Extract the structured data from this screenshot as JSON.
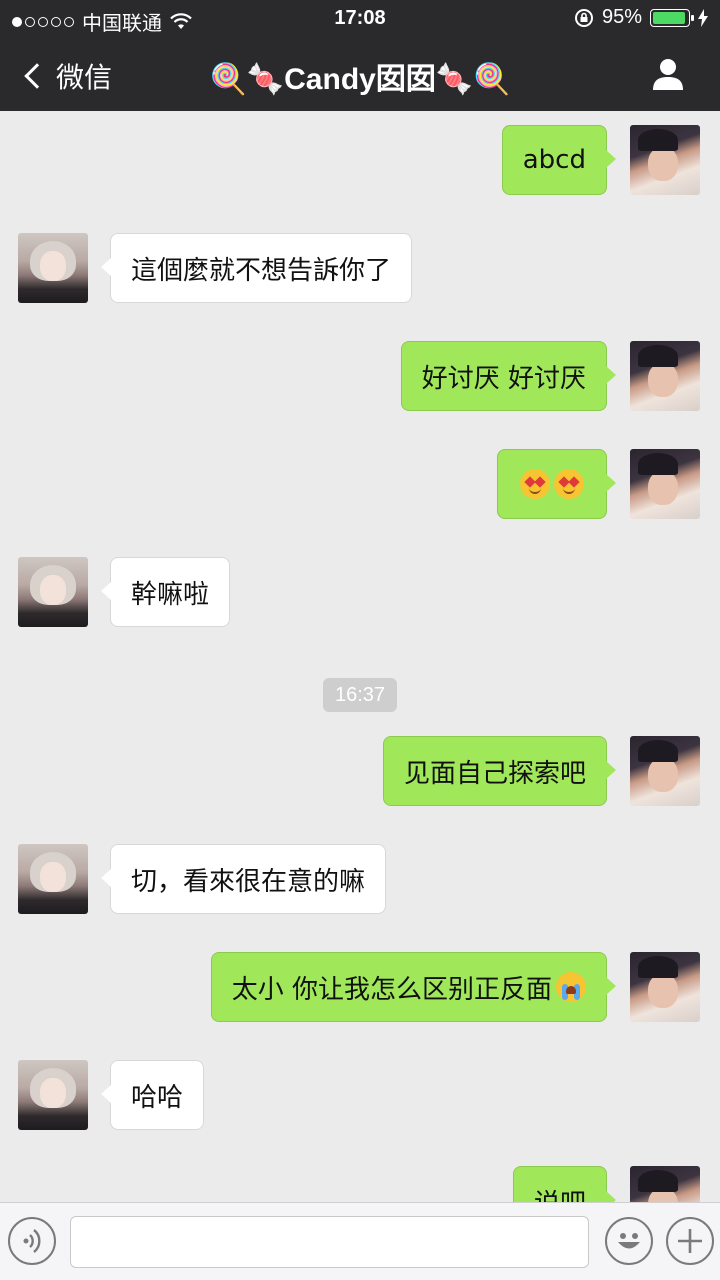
{
  "status_bar": {
    "carrier": "中国联通",
    "time": "17:08",
    "battery": "95%",
    "battery_level": 0.95
  },
  "nav": {
    "back_label": "微信",
    "title": "🍭🍬Candy囡囡🍬🍭"
  },
  "messages": [
    {
      "from": "me",
      "text": "abcd"
    },
    {
      "from": "her",
      "text": "這個麼就不想告訴你了"
    },
    {
      "from": "me",
      "text": "好讨厌 好讨厌"
    },
    {
      "from": "me",
      "text": "",
      "icons": [
        "heart-eyes-emoji",
        "heart-eyes-emoji"
      ]
    },
    {
      "from": "her",
      "text": "幹嘛啦"
    },
    {
      "from": "me",
      "text": "见面自己探索吧"
    },
    {
      "from": "her",
      "text": "切，看來很在意的嘛"
    },
    {
      "from": "me",
      "text": "太小 你让我怎么区别正反面",
      "icons": [
        "crying-emoji"
      ]
    },
    {
      "from": "her",
      "text": "哈哈"
    },
    {
      "from": "me",
      "text": "说吧"
    }
  ],
  "timestamp": "16:37",
  "input_bar": {
    "placeholder": "",
    "icons": [
      "voice-icon",
      "emoji-icon",
      "plus-icon"
    ]
  }
}
